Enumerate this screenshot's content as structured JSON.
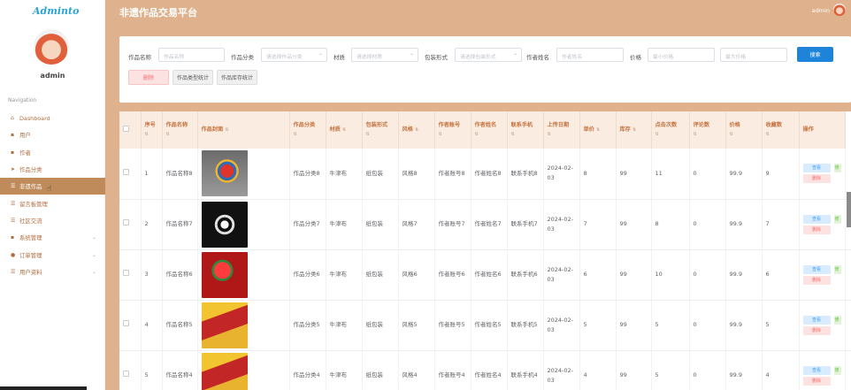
{
  "app": {
    "brand": "Adminto",
    "title": "非遗作品交易平台",
    "user": "admin",
    "sidebar_user": "admin"
  },
  "nav": {
    "heading": "Navigation",
    "items": [
      {
        "label": "Dashboard",
        "icon": "home-icon"
      },
      {
        "label": "用户",
        "icon": "grid-icon"
      },
      {
        "label": "作者",
        "icon": "grid-icon"
      },
      {
        "label": "作品分类",
        "icon": "send-icon"
      },
      {
        "label": "非遗作品",
        "icon": "list-icon"
      },
      {
        "label": "留言板管理",
        "icon": "list-icon"
      },
      {
        "label": "社区交流",
        "icon": "list-icon"
      },
      {
        "label": "系统管理",
        "icon": "grid-icon"
      },
      {
        "label": "订单管理",
        "icon": "user-icon"
      },
      {
        "label": "用户资料",
        "icon": "list-icon"
      }
    ]
  },
  "filters": {
    "name_label": "作品名称",
    "name_ph": "作品名称",
    "cat_label": "作品分类",
    "cat_ph": "请选择作品分类",
    "mat_label": "材质",
    "mat_ph": "请选择材质",
    "pack_label": "包装形式",
    "pack_ph": "请选择包装形式",
    "author_label": "作者姓名",
    "author_ph": "作者姓名",
    "price_label": "价格",
    "min_ph": "最小价格",
    "max_ph": "最大价格",
    "search": "搜索",
    "delete": "删除",
    "stat_type": "作品类型统计",
    "stat_stock": "作品库存统计"
  },
  "table": {
    "headers": [
      "序号",
      "作品名称",
      "作品封面",
      "作品分类",
      "材质",
      "包装形式",
      "风格",
      "作者账号",
      "作者姓名",
      "联系手机",
      "上传日期",
      "单价",
      "库存",
      "点击次数",
      "评论数",
      "价格",
      "收藏数",
      "操作"
    ],
    "view": "查看",
    "del": "删除",
    "edit": "修",
    "rows": [
      {
        "no": "1",
        "name": "作品名称8",
        "cat": "作品分类8",
        "mat": "牛津布",
        "pack": "纸包装",
        "style": "风格8",
        "acc": "作者账号8",
        "aname": "作者姓名8",
        "phone": "联系手机8",
        "date": "2024-02-03",
        "unit": "8",
        "stock": "99",
        "clicks": "11",
        "comments": "0",
        "price": "99.9",
        "fav": "9"
      },
      {
        "no": "2",
        "name": "作品名称7",
        "cat": "作品分类7",
        "mat": "牛津布",
        "pack": "纸包装",
        "style": "风格7",
        "acc": "作者账号7",
        "aname": "作者姓名7",
        "phone": "联系手机7",
        "date": "2024-02-03",
        "unit": "7",
        "stock": "99",
        "clicks": "8",
        "comments": "0",
        "price": "99.9",
        "fav": "7"
      },
      {
        "no": "3",
        "name": "作品名称6",
        "cat": "作品分类6",
        "mat": "牛津布",
        "pack": "纸包装",
        "style": "风格6",
        "acc": "作者账号6",
        "aname": "作者姓名6",
        "phone": "联系手机6",
        "date": "2024-02-03",
        "unit": "6",
        "stock": "99",
        "clicks": "10",
        "comments": "0",
        "price": "99.9",
        "fav": "6"
      },
      {
        "no": "4",
        "name": "作品名称5",
        "cat": "作品分类5",
        "mat": "牛津布",
        "pack": "纸包装",
        "style": "风格5",
        "acc": "作者账号5",
        "aname": "作者姓名5",
        "phone": "联系手机5",
        "date": "2024-02-03",
        "unit": "5",
        "stock": "99",
        "clicks": "5",
        "comments": "0",
        "price": "99.9",
        "fav": "5"
      },
      {
        "no": "5",
        "name": "作品名称4",
        "cat": "作品分类4",
        "mat": "牛津布",
        "pack": "纸包装",
        "style": "风格4",
        "acc": "作者账号4",
        "aname": "作者姓名4",
        "phone": "联系手机4",
        "date": "2024-02-03",
        "unit": "4",
        "stock": "99",
        "clicks": "5",
        "comments": "0",
        "price": "99.9",
        "fav": "4"
      }
    ]
  },
  "colors": {
    "accent": "#c08b5b",
    "header_bg": "#dfb28d",
    "primary": "#1d84da"
  }
}
